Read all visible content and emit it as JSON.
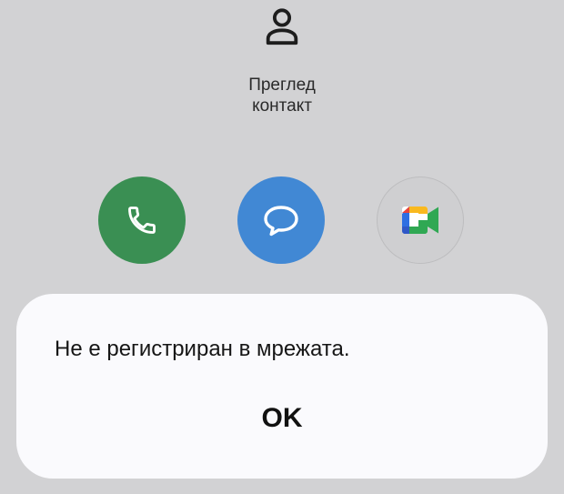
{
  "contact": {
    "view_label_line1": "Преглед",
    "view_label_line2": "контакт",
    "icon": "person-outline-icon"
  },
  "actions": [
    {
      "name": "call",
      "icon": "phone-icon",
      "color": "#3a8f53"
    },
    {
      "name": "message",
      "icon": "chat-bubble-icon",
      "color": "#4188d4"
    },
    {
      "name": "video-call",
      "icon": "google-meet-icon",
      "color": "#cfcfd1"
    }
  ],
  "dialog": {
    "message": "Не е регистриран в мрежата.",
    "ok_label": "OK"
  }
}
